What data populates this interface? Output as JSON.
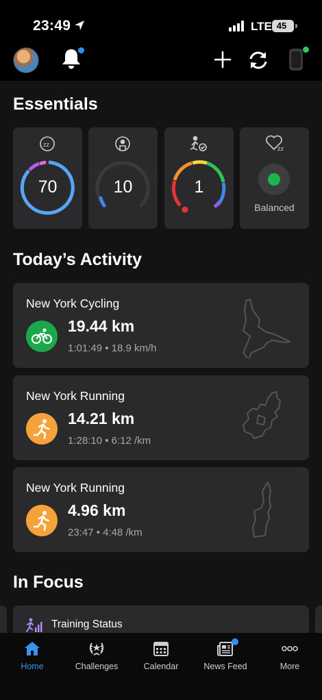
{
  "status_bar": {
    "time": "23:49",
    "network": "LTE",
    "battery": "45"
  },
  "essentials": {
    "title": "Essentials",
    "cards": [
      {
        "icon": "sleep-score-icon",
        "value": "70",
        "label": ""
      },
      {
        "icon": "body-battery-icon",
        "value": "10",
        "label": ""
      },
      {
        "icon": "intensity-minutes-icon",
        "value": "1",
        "label": ""
      },
      {
        "icon": "hrv-status-icon",
        "value": "",
        "label": "Balanced",
        "status_color": "#1db44c"
      }
    ]
  },
  "activity": {
    "title": "Today’s Activity",
    "items": [
      {
        "title": "New York Cycling",
        "distance": "19.44 km",
        "meta": "1:01:49 • 18.9 km/h",
        "type": "cycling",
        "color": "#1ca84a"
      },
      {
        "title": "New York Running",
        "distance": "14.21 km",
        "meta": "1:28:10 • 6:12 /km",
        "type": "running",
        "color": "#f6a23a"
      },
      {
        "title": "New York Running",
        "distance": "4.96 km",
        "meta": "23:47 • 4:48 /km",
        "type": "running",
        "color": "#f6a23a"
      }
    ]
  },
  "focus": {
    "title": "In Focus",
    "card_label": "Training Status"
  },
  "nav": {
    "items": [
      {
        "label": "Home",
        "icon": "home-icon",
        "active": true
      },
      {
        "label": "Challenges",
        "icon": "laurel-icon"
      },
      {
        "label": "Calendar",
        "icon": "calendar-icon"
      },
      {
        "label": "News Feed",
        "icon": "newspaper-icon"
      },
      {
        "label": "More",
        "icon": "more-icon"
      }
    ]
  },
  "colors": {
    "accent": "#3a92ec",
    "card": "#2a2a2c",
    "background": "#131313"
  }
}
